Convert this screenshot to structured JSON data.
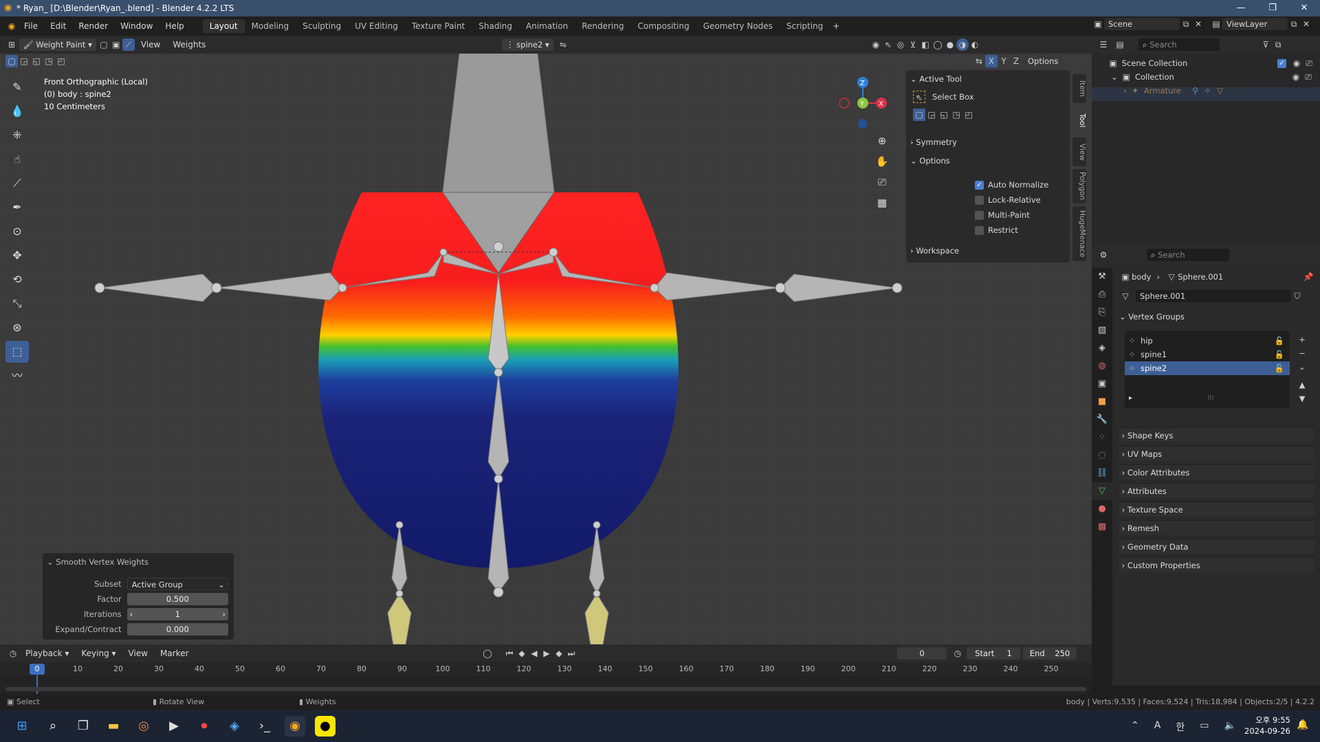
{
  "window": {
    "title": "* Ryan_ [D:\\Blender\\Ryan_.blend] - Blender 4.2.2 LTS"
  },
  "menu": [
    "File",
    "Edit",
    "Render",
    "Window",
    "Help"
  ],
  "workspaces": [
    "Layout",
    "Modeling",
    "Sculpting",
    "UV Editing",
    "Texture Paint",
    "Shading",
    "Animation",
    "Rendering",
    "Compositing",
    "Geometry Nodes",
    "Scripting"
  ],
  "header": {
    "mode": "Weight Paint",
    "view": "View",
    "weights": "Weights",
    "bone": "spine2",
    "options": "Options"
  },
  "viewport": {
    "line1": "Front Orthographic (Local)",
    "line2": "(0) body : spine2",
    "line3": "10 Centimeters"
  },
  "gizmo": {
    "z": "Z",
    "y": "Y",
    "x": "X"
  },
  "npanel": {
    "active_tool": "Active Tool",
    "select_box": "Select Box",
    "symmetry": "Symmetry",
    "options": "Options",
    "auto_normalize": "Auto Normalize",
    "lock_relative": "Lock-Relative",
    "multi_paint": "Multi-Paint",
    "restrict": "Restrict",
    "workspace": "Workspace",
    "tabs": [
      "Item",
      "Tool",
      "View",
      "Polygon",
      "HugeMenace"
    ]
  },
  "operator_panel": {
    "title": "Smooth Vertex Weights",
    "subset_label": "Subset",
    "subset_value": "Active Group",
    "factor_label": "Factor",
    "factor_value": "0.500",
    "iterations_label": "Iterations",
    "iterations_value": "1",
    "expand_label": "Expand/Contract",
    "expand_value": "0.000"
  },
  "outliner": {
    "scene": "Scene",
    "view_layer": "ViewLayer",
    "search": "Search",
    "scene_collection": "Scene Collection",
    "collection": "Collection",
    "armature": "Armature"
  },
  "properties": {
    "search": "Search",
    "breadcrumb_obj": "body",
    "breadcrumb_mesh": "Sphere.001",
    "mesh_name": "Sphere.001",
    "vertex_groups_title": "Vertex Groups",
    "vertex_groups": [
      "hip",
      "spine1",
      "spine2"
    ],
    "active_group": "spine2",
    "sections": [
      "Shape Keys",
      "UV Maps",
      "Color Attributes",
      "Attributes",
      "Texture Space",
      "Remesh",
      "Geometry Data",
      "Custom Properties"
    ]
  },
  "timeline": {
    "playback": "Playback",
    "keying": "Keying",
    "view": "View",
    "marker": "Marker",
    "current": "0",
    "start_label": "Start",
    "start": "1",
    "end_label": "End",
    "end": "250",
    "ticks": [
      "0",
      "10",
      "20",
      "30",
      "40",
      "50",
      "60",
      "70",
      "80",
      "90",
      "100",
      "110",
      "120",
      "130",
      "140",
      "150",
      "160",
      "170",
      "180",
      "190",
      "200",
      "210",
      "220",
      "230",
      "240",
      "250"
    ]
  },
  "status": {
    "select": "Select",
    "rotate": "Rotate View",
    "weights": "Weights",
    "stats": "body | Verts:9,535 | Faces:9,524 | Tris:18,984 | Objects:2/5 | 4.2.2"
  },
  "taskbar": {
    "time": "오후 9:55",
    "date": "2024-09-26",
    "ime": "A",
    "lang": "한"
  },
  "colors": {
    "accent": "#4a7fd3",
    "titlebar": "#39506d",
    "selected": "#3d5f96"
  }
}
